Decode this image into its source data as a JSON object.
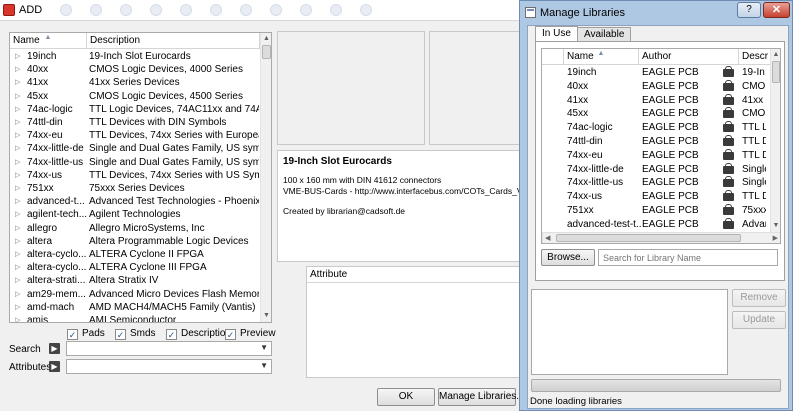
{
  "add_window": {
    "title": "ADD",
    "list": {
      "col_name": "Name",
      "col_description": "Description",
      "rows": [
        {
          "name": "19inch",
          "description": "19-Inch Slot Eurocards"
        },
        {
          "name": "40xx",
          "description": "CMOS Logic Devices, 4000 Series"
        },
        {
          "name": "41xx",
          "description": "41xx Series Devices"
        },
        {
          "name": "45xx",
          "description": "CMOS Logic Devices, 4500 Series"
        },
        {
          "name": "74ac-logic",
          "description": "TTL Logic Devices, 74AC11xx and 74AC1..."
        },
        {
          "name": "74ttl-din",
          "description": "TTL Devices with DIN Symbols"
        },
        {
          "name": "74xx-eu",
          "description": "TTL Devices, 74xx Series with European S..."
        },
        {
          "name": "74xx-little-de",
          "description": "Single and Dual Gates Family, US symbols"
        },
        {
          "name": "74xx-little-us",
          "description": "Single and Dual Gates Family, US symbols"
        },
        {
          "name": "74xx-us",
          "description": "TTL Devices, 74xx Series with US Symbols"
        },
        {
          "name": "751xx",
          "description": "75xxx Series Devices"
        },
        {
          "name": "advanced-t...",
          "description": "Advanced Test Technologies - Phoenix, ..."
        },
        {
          "name": "agilent-tech...",
          "description": "Agilent Technologies"
        },
        {
          "name": "allegro",
          "description": "Allegro MicroSystems, Inc"
        },
        {
          "name": "altera",
          "description": "Altera Programmable Logic Devices"
        },
        {
          "name": "altera-cyclo...",
          "description": "ALTERA Cyclone II FPGA"
        },
        {
          "name": "altera-cyclo...",
          "description": "ALTERA Cyclone III FPGA"
        },
        {
          "name": "altera-strati...",
          "description": "Altera Stratix IV"
        },
        {
          "name": "am29-mem...",
          "description": "Advanced Micro Devices Flash Memories"
        },
        {
          "name": "amd-mach",
          "description": "AMD MACH4/MACH5 Family (Vantis)"
        },
        {
          "name": "amis",
          "description": "AMI Semiconductor"
        }
      ]
    },
    "checkboxes": {
      "pads": "Pads",
      "smds": "Smds",
      "description": "Description",
      "preview": "Preview"
    },
    "search_label": "Search",
    "attributes_label": "Attributes",
    "preview": {
      "title": "19-Inch Slot Eurocards",
      "line1": "100 x 160 mm with DIN 41612 connectors",
      "line2": "VME-BUS-Cards - http://www.interfacebus.com/COTs_Cards_VM...",
      "line3": "Created by librarian@cadsoft.de"
    },
    "attribute_header": "Attribute",
    "ok_label": "OK",
    "manage_libraries_label": "Manage Libraries..."
  },
  "manage_libraries": {
    "title": "Manage Libraries",
    "help_label": "?",
    "close_label": "✕",
    "tabs": [
      "In Use",
      "Available"
    ],
    "list": {
      "col_name": "Name",
      "col_author": "Author",
      "col_description": "Descr",
      "rows": [
        {
          "name": "19inch",
          "author": "EAGLE PCB",
          "description": "19-In"
        },
        {
          "name": "40xx",
          "author": "EAGLE PCB",
          "description": "CMOS"
        },
        {
          "name": "41xx",
          "author": "EAGLE PCB",
          "description": "41xx S"
        },
        {
          "name": "45xx",
          "author": "EAGLE PCB",
          "description": "CMOS"
        },
        {
          "name": "74ac-logic",
          "author": "EAGLE PCB",
          "description": "TTL L"
        },
        {
          "name": "74ttl-din",
          "author": "EAGLE PCB",
          "description": "TTL D"
        },
        {
          "name": "74xx-eu",
          "author": "EAGLE PCB",
          "description": "TTL D"
        },
        {
          "name": "74xx-little-de",
          "author": "EAGLE PCB",
          "description": "Single"
        },
        {
          "name": "74xx-little-us",
          "author": "EAGLE PCB",
          "description": "Single"
        },
        {
          "name": "74xx-us",
          "author": "EAGLE PCB",
          "description": "TTL D"
        },
        {
          "name": "751xx",
          "author": "EAGLE PCB",
          "description": "75xxx"
        },
        {
          "name": "advanced-test-t...",
          "author": "EAGLE PCB",
          "description": "Advar"
        }
      ]
    },
    "browse_label": "Browse...",
    "search_placeholder": "Search for Library Name",
    "remove_label": "Remove",
    "update_label": "Update",
    "status": "Done loading libraries"
  }
}
